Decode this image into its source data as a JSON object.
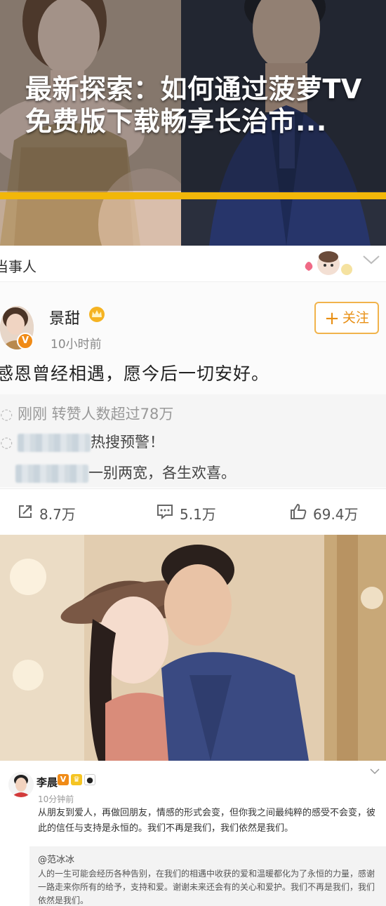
{
  "hero": {
    "title": "最新探索：如何通过菠萝TV免费版下载畅享长治市...",
    "accent_color": "#f2b709"
  },
  "weibo_post": {
    "topic_label": "当事人",
    "author": "景甜",
    "time": "10小时前",
    "follow_label": "关注",
    "text": "感恩曾经相遇，愿今后一切安好。",
    "retweet_line1": "刚刚 转赞人数超过78万",
    "retweet_line2": "热搜预警！",
    "retweet_line3": "一别两宽，各生欢喜。",
    "stats": {
      "reposts": "8.7万",
      "comments": "5.1万",
      "likes": "69.4万"
    },
    "icons": [
      "crown-icon",
      "verified-icon",
      "share-icon",
      "comment-icon",
      "like-icon",
      "chevron-down-icon"
    ]
  },
  "weibo_post2": {
    "author": "李晨",
    "time": "10分钟前",
    "text": "从朋友到爱人，再做回朋友，情感的形式会变，但你我之间最纯粹的感受不会变，彼此的信任与支持是永恒的。我们不再是我们，我们依然是我们。",
    "quote_author": "@范冰冰",
    "quote_text": "人的一生可能会经历各种告别，在我们的相遇中收获的爱和温暖都化为了永恒的力量，感谢一路走来你所有的给予，支持和爱。谢谢未来还会有的关心和爱护。我们不再是我们，我们依然是我们。"
  }
}
